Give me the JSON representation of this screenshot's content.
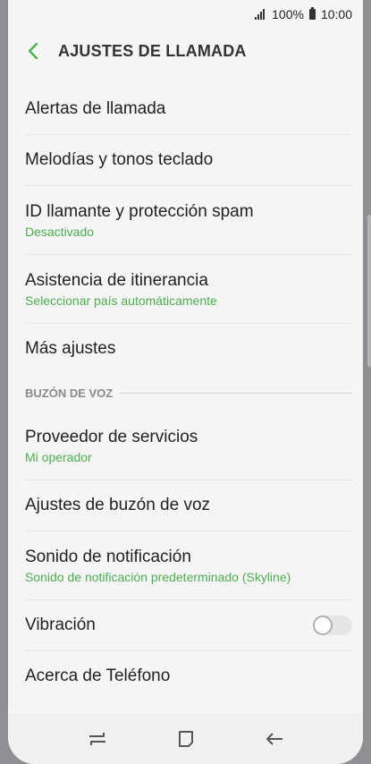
{
  "status": {
    "battery_level": "100%",
    "time": "10:00",
    "icons": [
      "signal-icon",
      "battery-icon"
    ]
  },
  "header": {
    "title": "AJUSTES DE LLAMADA",
    "back_icon": "chevron-left-icon"
  },
  "items_top": [
    {
      "label": "Alertas de llamada"
    },
    {
      "label": "Melodías y tonos teclado"
    },
    {
      "label": "ID llamante y protección spam",
      "sub": "Desactivado"
    },
    {
      "label": "Asistencia de itinerancia",
      "sub": "Seleccionar país automáticamente"
    },
    {
      "label": "Más ajustes"
    }
  ],
  "voicemail_section": {
    "header": "BUZÓN DE VOZ"
  },
  "items_bottom": [
    {
      "label": "Proveedor de servicios",
      "sub": "Mi operador"
    },
    {
      "label": "Ajustes de buzón de voz"
    },
    {
      "label": "Sonido de notificación",
      "sub": "Sonido de notificación predeterminado (Skyline)"
    },
    {
      "label": "Vibración",
      "toggle": false
    },
    {
      "label": "Acerca de Teléfono"
    }
  ],
  "navbar": {
    "icons": [
      "recent-apps-icon",
      "home-icon",
      "back-icon"
    ]
  },
  "colors": {
    "accent": "#4caf50",
    "background": "#f5f5f5",
    "text": "#222222"
  }
}
